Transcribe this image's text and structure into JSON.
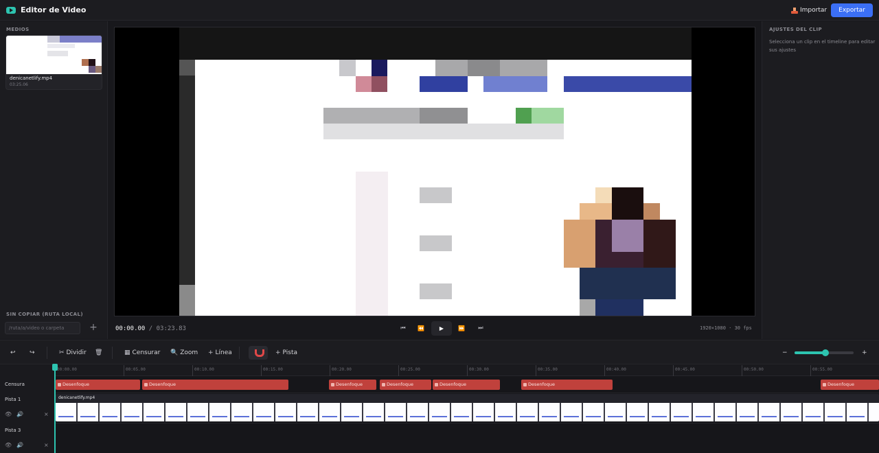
{
  "header": {
    "app_title": "Editor de Video",
    "import_label": "Importar",
    "export_label": "Exportar"
  },
  "left_panel": {
    "media_title": "MEDIOS",
    "media_items": [
      {
        "name": "denicanetlify.mp4",
        "duration": "03:25.06"
      }
    ],
    "local_title": "SIN COPIAR (RUTA LOCAL)",
    "local_placeholder": "/ruta/a/video o carpeta",
    "add_icon": "+"
  },
  "player": {
    "current_time": "00:00.00",
    "separator": "/",
    "total_time": "03:23.83",
    "resolution_info": "1920×1080 · 30 fps",
    "controls": {
      "skip_start": "⏮",
      "rewind": "⏪",
      "play": "▶",
      "forward": "⏩",
      "skip_end": "⏭"
    }
  },
  "right_panel": {
    "title": "AJUSTES DEL CLIP",
    "hint": "Selecciona un clip en el timeline para editar sus ajustes"
  },
  "toolbar": {
    "undo": "↩",
    "redo": "↪",
    "split_label": "Dividir",
    "split_icon": "✂",
    "delete_icon": "🗑",
    "censor_label": "Censurar",
    "censor_icon": "▦",
    "zoom_label": "Zoom",
    "zoom_icon": "🔍",
    "line_label": "Línea",
    "line_icon": "+",
    "track_label": "Pista",
    "track_icon": "+",
    "zoom_out": "−",
    "zoom_in": "+",
    "zoom_level": 0.52
  },
  "timeline": {
    "ticks": [
      "00:00.00",
      "00:05.00",
      "00:10.00",
      "00:15.00",
      "00:20.00",
      "00:25.00",
      "00:30.00",
      "00:35.00",
      "00:40.00",
      "00:45.00",
      "00:50.00",
      "00:55.00"
    ],
    "tracks": {
      "censor": "Censura",
      "track1": "Pista 1",
      "track3": "Pista 3"
    },
    "blur_label": "Desenfoque",
    "clip_name": "denicanetlify.mp4",
    "eye_icon": "👁",
    "audio_icon": "🔊",
    "close_icon": "×"
  },
  "colors": {
    "accent": "#2dc4b0",
    "export": "#3b6ff5",
    "censor": "#c0413c"
  }
}
